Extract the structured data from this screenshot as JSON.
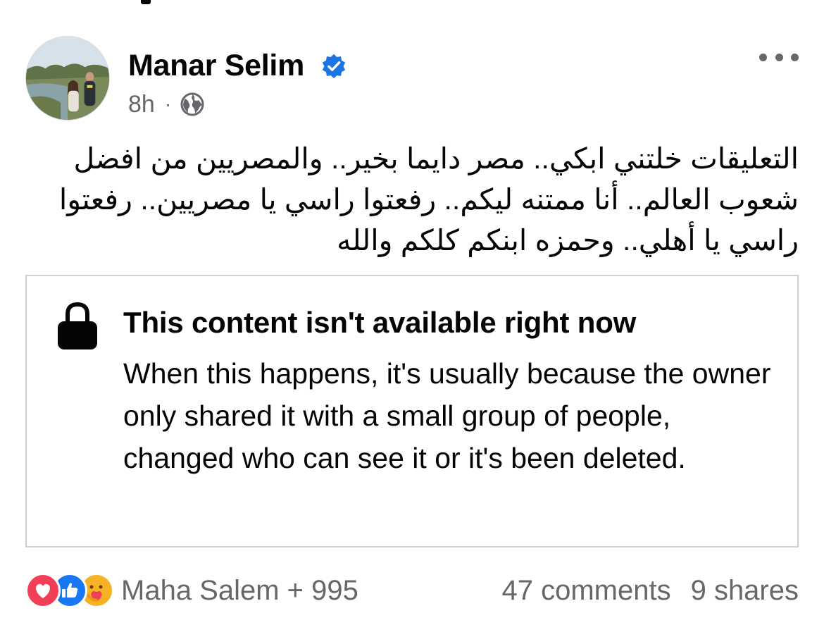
{
  "post": {
    "author": "Manar Selim",
    "verified_icon": "verified-badge-icon",
    "time": "8h",
    "separator": "·",
    "privacy_icon": "globe-icon",
    "more_icon": "more-options-icon",
    "text": "التعليقات خلتني ابكي.. مصر دايما بخير.. والمصريين من افضل شعوب العالم.. أنا ممتنه ليكم.. رفعتوا راسي يا مصريين.. رفعتوا راسي يا أهلي.. وحمزه ابنكم كلكم والله"
  },
  "unavailable": {
    "icon": "lock-icon",
    "title": "This content isn't available right now",
    "body": "When this happens, it's usually because the owner only shared it with a small group of people, changed who can see it or it's been deleted."
  },
  "footer": {
    "reaction_icons": [
      "love-reaction-icon",
      "like-reaction-icon",
      "care-reaction-icon"
    ],
    "reactions_text": "Maha Salem + 995",
    "comments": "47 comments",
    "shares": "9 shares"
  },
  "colors": {
    "text": "#050505",
    "secondary_text": "#65676b",
    "verified_blue": "#1b74e4",
    "like_blue": "#1877f2",
    "love_red": "#f33e58",
    "care_yellow": "#f7b125",
    "border": "#ced0d4"
  }
}
